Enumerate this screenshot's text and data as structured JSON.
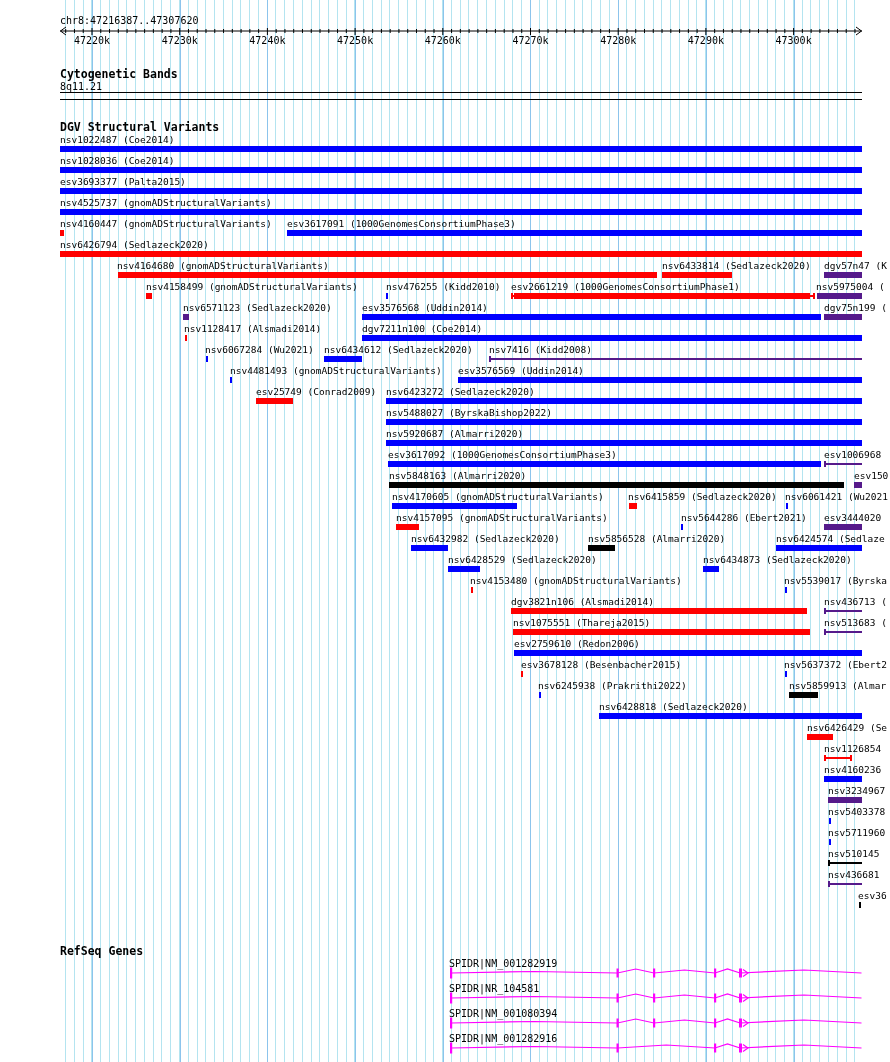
{
  "ruler": {
    "location": "chr8:47216387..47307620",
    "tick_labels": [
      "47220k",
      "47230k",
      "47240k",
      "47250k",
      "47260k",
      "47270k",
      "47280k",
      "47290k",
      "47300k"
    ]
  },
  "cytogenetic_bands": {
    "title": "Cytogenetic Bands",
    "band": "8q11.21"
  },
  "dgv_structural_variants": {
    "title": "DGV Structural Variants",
    "rows": [
      {
        "features": [
          {
            "label": "nsv1022487 (Coe2014)",
            "kind": "bar",
            "color": "#0000ff"
          }
        ]
      },
      {
        "features": [
          {
            "label": "nsv1028036 (Coe2014)",
            "kind": "bar",
            "color": "#0000ff"
          }
        ]
      },
      {
        "features": [
          {
            "label": "esv3693377 (Palta2015)",
            "kind": "bar",
            "color": "#0000ff"
          }
        ]
      },
      {
        "features": [
          {
            "label": "nsv4525737 (gnomADStructuralVariants)",
            "kind": "bar",
            "color": "#0000ff"
          }
        ]
      },
      {
        "features": [
          {
            "label": "nsv4160447 (gnomADStructuralVariants)",
            "kind": "bar",
            "color": "#ff0000"
          },
          {
            "label": "esv3617091 (1000GenomesConsortiumPhase3)",
            "kind": "bar",
            "color": "#0000ff"
          }
        ]
      },
      {
        "features": [
          {
            "label": "nsv6426794 (Sedlazeck2020)",
            "kind": "bar",
            "color": "#ff0000"
          }
        ]
      },
      {
        "features": [
          {
            "label": "nsv4164680 (gnomADStructuralVariants)",
            "kind": "bar",
            "color": "#ff0000"
          },
          {
            "label": "nsv6433814 (Sedlazeck2020)",
            "kind": "bar",
            "color": "#ff0000"
          },
          {
            "label": "dgv57n47 (K",
            "kind": "bar",
            "color": "#551a8b"
          }
        ]
      },
      {
        "features": [
          {
            "label": "nsv4158499 (gnomADStructuralVariants)",
            "kind": "bar",
            "color": "#ff0000"
          },
          {
            "label": "nsv476255 (Kidd2010)",
            "kind": "bar",
            "color": "#0000ff"
          },
          {
            "label": "esv2661219 (1000GenomesConsortiumPhase1)",
            "kind": "bracketed",
            "color": "#ff0000"
          },
          {
            "label": "nsv5975004 (",
            "kind": "bar",
            "color": "#551a8b"
          }
        ]
      },
      {
        "features": [
          {
            "label": "nsv6571123 (Sedlazeck2020)",
            "kind": "bar",
            "color": "#551a8b"
          },
          {
            "label": "esv3576568 (Uddin2014)",
            "kind": "bar",
            "color": "#0000ff"
          },
          {
            "label": "dgv75n199 (",
            "kind": "bar",
            "color": "#551a8b"
          }
        ]
      },
      {
        "features": [
          {
            "label": "nsv1128417 (Alsmadi2014)",
            "kind": "bar",
            "color": "#ff0000"
          },
          {
            "label": "dgv7211n100 (Coe2014)",
            "kind": "bar",
            "color": "#0000ff"
          }
        ]
      },
      {
        "features": [
          {
            "label": "nsv6067284 (Wu2021)",
            "kind": "bar",
            "color": "#0000ff"
          },
          {
            "label": "nsv6434612 (Sedlazeck2020)",
            "kind": "bar",
            "color": "#0000ff"
          },
          {
            "label": "nsv7416 (Kidd2008)",
            "kind": "line",
            "color": "#551a8b"
          }
        ]
      },
      {
        "features": [
          {
            "label": "nsv4481493 (gnomADStructuralVariants)",
            "kind": "bar",
            "color": "#0000ff"
          },
          {
            "label": "esv3576569 (Uddin2014)",
            "kind": "bar",
            "color": "#0000ff"
          }
        ]
      },
      {
        "features": [
          {
            "label": "esv25749 (Conrad2009)",
            "kind": "bar",
            "color": "#ff0000"
          },
          {
            "label": "nsv6423272 (Sedlazeck2020)",
            "kind": "bar",
            "color": "#0000ff"
          }
        ]
      },
      {
        "features": [
          {
            "label": "nsv5488027 (ByrskaBishop2022)",
            "kind": "bar",
            "color": "#0000ff"
          }
        ]
      },
      {
        "features": [
          {
            "label": "nsv5920687 (Almarri2020)",
            "kind": "bar",
            "color": "#0000ff"
          }
        ]
      },
      {
        "features": [
          {
            "label": "esv3617092 (1000GenomesConsortiumPhase3)",
            "kind": "bar",
            "color": "#0000ff"
          },
          {
            "label": "esv1006968",
            "kind": "line",
            "color": "#551a8b"
          }
        ]
      },
      {
        "features": [
          {
            "label": "nsv5848163 (Almarri2020)",
            "kind": "bar",
            "color": "#000000"
          },
          {
            "label": "esv150",
            "kind": "bar",
            "color": "#551a8b"
          }
        ]
      },
      {
        "features": [
          {
            "label": "nsv4170605 (gnomADStructuralVariants)",
            "kind": "bar",
            "color": "#0000ff"
          },
          {
            "label": "nsv6415859 (Sedlazeck2020)",
            "kind": "bar",
            "color": "#ff0000"
          },
          {
            "label": "nsv6061421 (Wu2021",
            "kind": "bar",
            "color": "#0000ff"
          }
        ]
      },
      {
        "features": [
          {
            "label": "nsv4157095 (gnomADStructuralVariants)",
            "kind": "bar",
            "color": "#ff0000"
          },
          {
            "label": "nsv5644286 (Ebert2021)",
            "kind": "bar",
            "color": "#0000ff"
          },
          {
            "label": "esv3444020",
            "kind": "bar",
            "color": "#551a8b"
          }
        ]
      },
      {
        "features": [
          {
            "label": "nsv6432982 (Sedlazeck2020)",
            "kind": "bar",
            "color": "#0000ff"
          },
          {
            "label": "nsv5856528 (Almarri2020)",
            "kind": "bar",
            "color": "#000000"
          },
          {
            "label": "nsv6424574 (Sedlaze",
            "kind": "bar",
            "color": "#0000ff"
          }
        ]
      },
      {
        "features": [
          {
            "label": "nsv6428529 (Sedlazeck2020)",
            "kind": "bar",
            "color": "#0000ff"
          },
          {
            "label": "nsv6434873 (Sedlazeck2020)",
            "kind": "bar",
            "color": "#0000ff"
          }
        ]
      },
      {
        "features": [
          {
            "label": "nsv4153480 (gnomADStructuralVariants)",
            "kind": "bar",
            "color": "#ff0000"
          },
          {
            "label": "nsv5539017 (Byrska",
            "kind": "bar",
            "color": "#0000ff"
          }
        ]
      },
      {
        "features": [
          {
            "label": "dgv3821n106 (Alsmadi2014)",
            "kind": "bar",
            "color": "#ff0000"
          },
          {
            "label": "nsv436713 (",
            "kind": "line",
            "color": "#551a8b"
          }
        ]
      },
      {
        "features": [
          {
            "label": "nsv1075551 (Thareja2015)",
            "kind": "bar",
            "color": "#ff0000"
          },
          {
            "label": "nsv513683 (",
            "kind": "line",
            "color": "#551a8b"
          }
        ]
      },
      {
        "features": [
          {
            "label": "esv2759610 (Redon2006)",
            "kind": "bar",
            "color": "#0000ff"
          }
        ]
      },
      {
        "features": [
          {
            "label": "esv3678128 (Besenbacher2015)",
            "kind": "bar",
            "color": "#ff0000"
          },
          {
            "label": "nsv5637372 (Ebert2",
            "kind": "bar",
            "color": "#0000ff"
          }
        ]
      },
      {
        "features": [
          {
            "label": "nsv6245938 (Prakrithi2022)",
            "kind": "bar",
            "color": "#0000ff"
          },
          {
            "label": "nsv5859913 (Almar",
            "kind": "bar",
            "color": "#000000"
          }
        ]
      },
      {
        "features": [
          {
            "label": "nsv6428818 (Sedlazeck2020)",
            "kind": "bar",
            "color": "#0000ff"
          }
        ]
      },
      {
        "features": [
          {
            "label": "nsv6426429 (Se",
            "kind": "bar",
            "color": "#ff0000"
          }
        ]
      },
      {
        "features": [
          {
            "label": "nsv1126854",
            "kind": "interval",
            "color": "#ff0000"
          }
        ]
      },
      {
        "features": [
          {
            "label": "nsv4160236",
            "kind": "bar",
            "color": "#0000ff"
          }
        ]
      },
      {
        "features": [
          {
            "label": "nsv3234967",
            "kind": "bar",
            "color": "#551a8b"
          }
        ]
      },
      {
        "features": [
          {
            "label": "nsv5403378",
            "kind": "bar",
            "color": "#0000ff"
          }
        ]
      },
      {
        "features": [
          {
            "label": "nsv5711960",
            "kind": "bar",
            "color": "#0000ff"
          }
        ]
      },
      {
        "features": [
          {
            "label": "nsv510145",
            "kind": "line",
            "color": "#000000"
          }
        ]
      },
      {
        "features": [
          {
            "label": "nsv436681",
            "kind": "line",
            "color": "#551a8b"
          }
        ]
      },
      {
        "features": [
          {
            "label": "esv36",
            "kind": "bar",
            "color": "#000000"
          }
        ]
      }
    ]
  },
  "refseq_genes": {
    "title": "RefSeq Genes",
    "transcripts": [
      {
        "label": "SPIDR|NM_001282919"
      },
      {
        "label": "SPIDR|NR_104581"
      },
      {
        "label": "SPIDR|NM_001080394"
      },
      {
        "label": "SPIDR|NM_001282916"
      }
    ]
  }
}
